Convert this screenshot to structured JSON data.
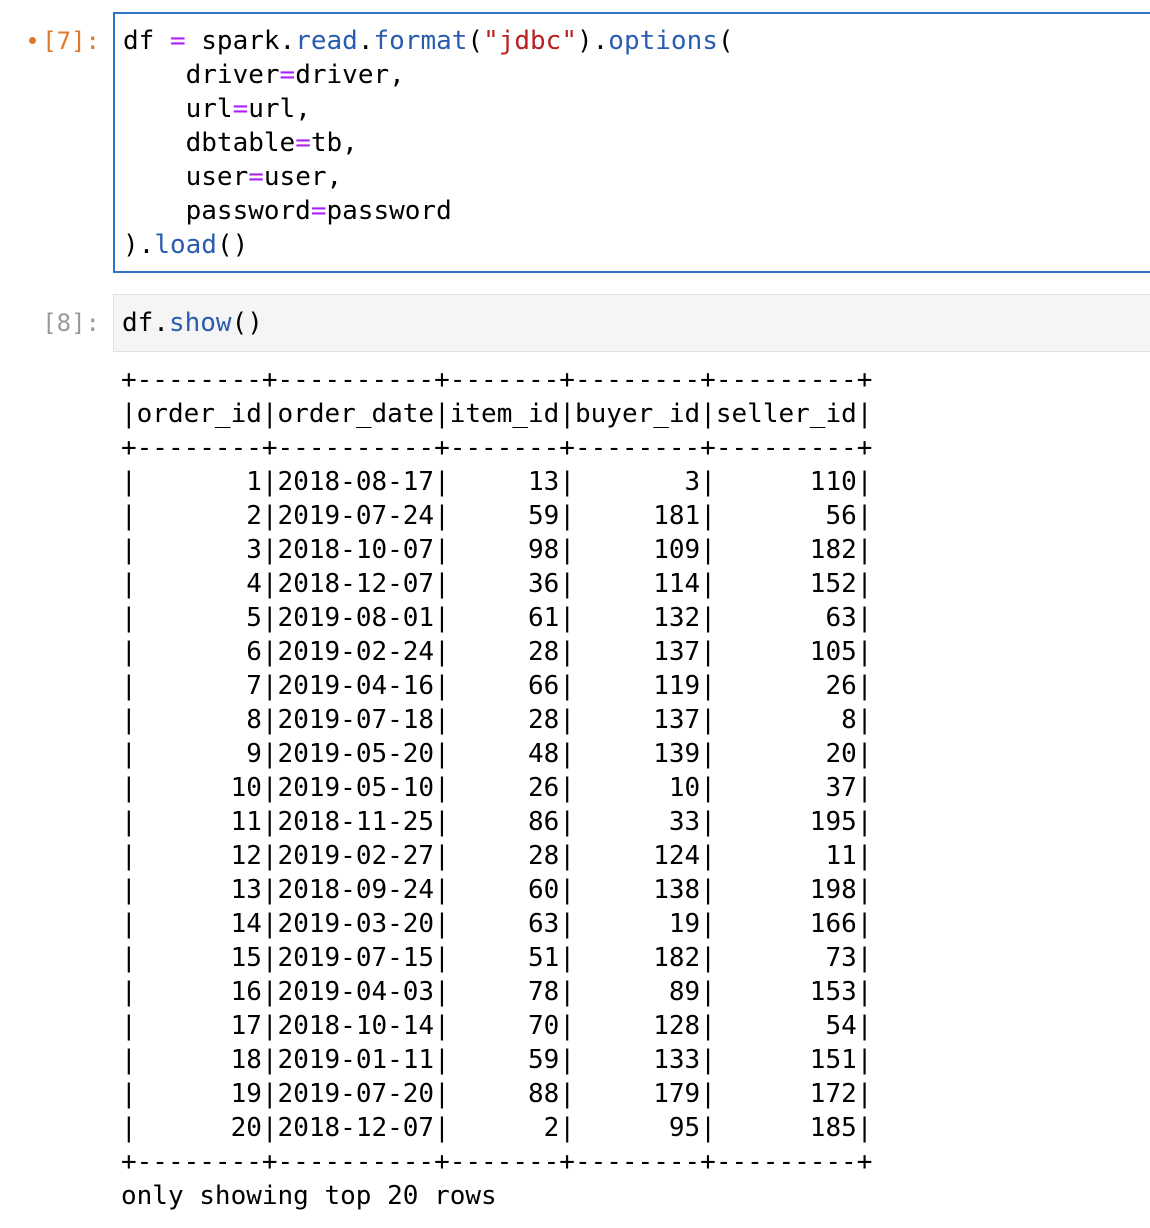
{
  "cells": [
    {
      "prompt": "[7]:",
      "code_lines": [
        "df = spark.read.format(\"jdbc\").options(",
        "    driver=driver,",
        "    url=url,",
        "    dbtable=tb,",
        "    user=user,",
        "    password=password",
        ").load()"
      ]
    },
    {
      "prompt": "[8]:",
      "code_lines": [
        "df.show()"
      ]
    }
  ],
  "output": {
    "separator": "+--------+----------+-------+--------+---------+",
    "columns": [
      "order_id",
      "order_date",
      "item_id",
      "buyer_id",
      "seller_id"
    ],
    "rows": [
      [
        "1",
        "2018-08-17",
        "13",
        "3",
        "110"
      ],
      [
        "2",
        "2019-07-24",
        "59",
        "181",
        "56"
      ],
      [
        "3",
        "2018-10-07",
        "98",
        "109",
        "182"
      ],
      [
        "4",
        "2018-12-07",
        "36",
        "114",
        "152"
      ],
      [
        "5",
        "2019-08-01",
        "61",
        "132",
        "63"
      ],
      [
        "6",
        "2019-02-24",
        "28",
        "137",
        "105"
      ],
      [
        "7",
        "2019-04-16",
        "66",
        "119",
        "26"
      ],
      [
        "8",
        "2019-07-18",
        "28",
        "137",
        "8"
      ],
      [
        "9",
        "2019-05-20",
        "48",
        "139",
        "20"
      ],
      [
        "10",
        "2019-05-10",
        "26",
        "10",
        "37"
      ],
      [
        "11",
        "2018-11-25",
        "86",
        "33",
        "195"
      ],
      [
        "12",
        "2019-02-27",
        "28",
        "124",
        "11"
      ],
      [
        "13",
        "2018-09-24",
        "60",
        "138",
        "198"
      ],
      [
        "14",
        "2019-03-20",
        "63",
        "19",
        "166"
      ],
      [
        "15",
        "2019-07-15",
        "51",
        "182",
        "73"
      ],
      [
        "16",
        "2019-04-03",
        "78",
        "89",
        "153"
      ],
      [
        "17",
        "2018-10-14",
        "70",
        "128",
        "54"
      ],
      [
        "18",
        "2019-01-11",
        "59",
        "133",
        "151"
      ],
      [
        "19",
        "2019-07-20",
        "88",
        "179",
        "172"
      ],
      [
        "20",
        "2018-12-07",
        "2",
        "95",
        "185"
      ]
    ],
    "footer": "only showing top 20 rows"
  }
}
